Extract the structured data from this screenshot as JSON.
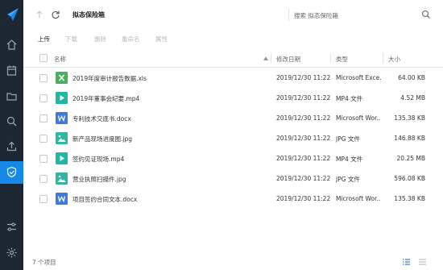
{
  "colors": {
    "sidebar_bg": "#1d2733",
    "accent": "#1787e8",
    "xls": "#47b15d",
    "mp4": "#1fb9a3",
    "doc": "#3d7bdc",
    "jpg": "#2fb7a0"
  },
  "sidebar": {
    "logo": "app-logo",
    "items": [
      {
        "icon": "home-icon"
      },
      {
        "icon": "calendar-icon"
      },
      {
        "icon": "folder-icon"
      },
      {
        "icon": "search-icon"
      },
      {
        "icon": "upload-icon"
      },
      {
        "icon": "shield-icon",
        "active": true
      }
    ],
    "bottom": [
      {
        "icon": "sliders-icon"
      },
      {
        "icon": "gear-icon"
      }
    ]
  },
  "topbar": {
    "path": "拟态保险箱",
    "search_placeholder": "搜索 拟态保险箱"
  },
  "toolbar": {
    "upload": "上传",
    "download": "下载",
    "delete": "删除",
    "rename": "重命名",
    "properties": "属性"
  },
  "table": {
    "headers": {
      "name": "名称",
      "date": "修改日期",
      "type": "类型",
      "size": "大小"
    },
    "rows": [
      {
        "name": "2019年度审计报告数据.xls",
        "date": "2019/12/30 11:22",
        "type": "Microsoft Exce...",
        "size": "64.00 KB",
        "kind": "xls"
      },
      {
        "name": "2019年董事会纪要.mp4",
        "date": "2019/12/30 11:22",
        "type": "MP4 文件",
        "size": "4.52 MB",
        "kind": "mp4"
      },
      {
        "name": "专利技术交底书.docx",
        "date": "2019/12/30 11:22",
        "type": "Microsoft Wor...",
        "size": "135.38 KB",
        "kind": "doc"
      },
      {
        "name": "新产品现场进度图.jpg",
        "date": "2019/12/30 11:22",
        "type": "JPG 文件",
        "size": "146.88 KB",
        "kind": "jpg"
      },
      {
        "name": "签约见证现场.mp4",
        "date": "2019/12/30 11:22",
        "type": "MP4 文件",
        "size": "20.25 MB",
        "kind": "mp4"
      },
      {
        "name": "营业执照扫描件.jpg",
        "date": "2019/12/30 11:22",
        "type": "JPG 文件",
        "size": "596.08 KB",
        "kind": "jpg"
      },
      {
        "name": "项目签约合同文本.docx",
        "date": "2019/12/30 11:22",
        "type": "Microsoft Wor...",
        "size": "135.38 KB",
        "kind": "doc"
      }
    ]
  },
  "footer": {
    "count": "7 个项目"
  }
}
